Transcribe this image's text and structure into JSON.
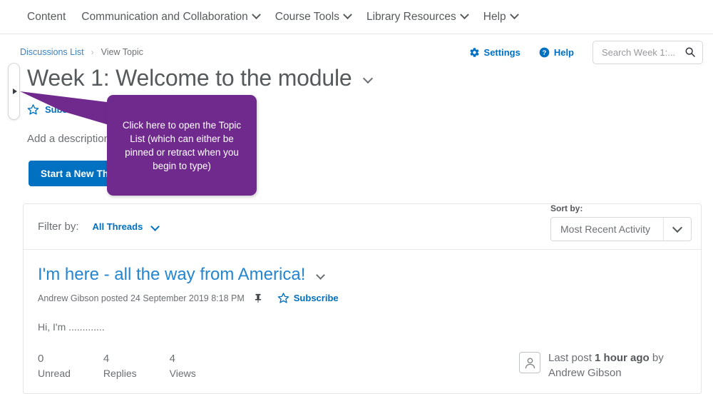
{
  "topnav": {
    "items": [
      {
        "label": "Content",
        "has_caret": false,
        "icon": ""
      },
      {
        "label": "Communication and Collaboration",
        "has_caret": true,
        "icon": "chevron-down-icon"
      },
      {
        "label": "Course Tools",
        "has_caret": true,
        "icon": "chevron-down-icon"
      },
      {
        "label": "Library Resources",
        "has_caret": true,
        "icon": "chevron-down-icon"
      },
      {
        "label": "Help",
        "has_caret": true,
        "icon": "chevron-down-icon"
      }
    ]
  },
  "breadcrumb": {
    "link": "Discussions List",
    "separator": "›",
    "current": "View Topic"
  },
  "tools": {
    "settings_label": "Settings",
    "settings_icon": "gear-icon",
    "help_label": "Help",
    "help_icon": "question-circle-icon"
  },
  "search": {
    "placeholder": "Search Week 1:...",
    "value": "",
    "icon": "search-icon"
  },
  "panel_handle": {
    "icon": "triangle-right-icon",
    "tooltip": "Open Topic List"
  },
  "page": {
    "title": "Week 1: Welcome to the module",
    "title_caret_icon": "chevron-down-icon",
    "subscribe_label": "Subscribe",
    "subscribe_icon": "star-outline-icon",
    "description_placeholder": "Add a description",
    "new_thread_button": "Start a New Thread"
  },
  "callout": {
    "text": "Click here to open the Topic List (which can either be pinned or retract when you begin to type)",
    "color": "#702a8e"
  },
  "filter": {
    "label": "Filter by:",
    "value": "All Threads",
    "caret_icon": "chevron-down-icon"
  },
  "sort": {
    "label": "Sort by:",
    "value": "Most Recent Activity",
    "caret_icon": "chevron-down-icon"
  },
  "thread": {
    "title": "I'm here - all the way from America!",
    "title_caret_icon": "chevron-down-icon",
    "meta": "Andrew Gibson posted 24 September 2019 8:18 PM",
    "pin_icon": "pin-icon",
    "subscribe_label": "Subscribe",
    "subscribe_icon": "star-outline-icon",
    "body": "Hi, I'm .............",
    "stats": [
      {
        "num": "0",
        "label": "Unread"
      },
      {
        "num": "4",
        "label": "Replies"
      },
      {
        "num": "4",
        "label": "Views"
      }
    ],
    "last_post": {
      "avatar_icon": "user-avatar-icon",
      "prefix": "Last post ",
      "time": "1 hour ago",
      "middle": " by",
      "author": "Andrew Gibson"
    }
  },
  "colors": {
    "link_blue": "#006fbf",
    "thread_blue": "#2485d0",
    "button_blue": "#0070c0",
    "callout_purple": "#702a8e",
    "text_grey": "#6b6f71"
  }
}
